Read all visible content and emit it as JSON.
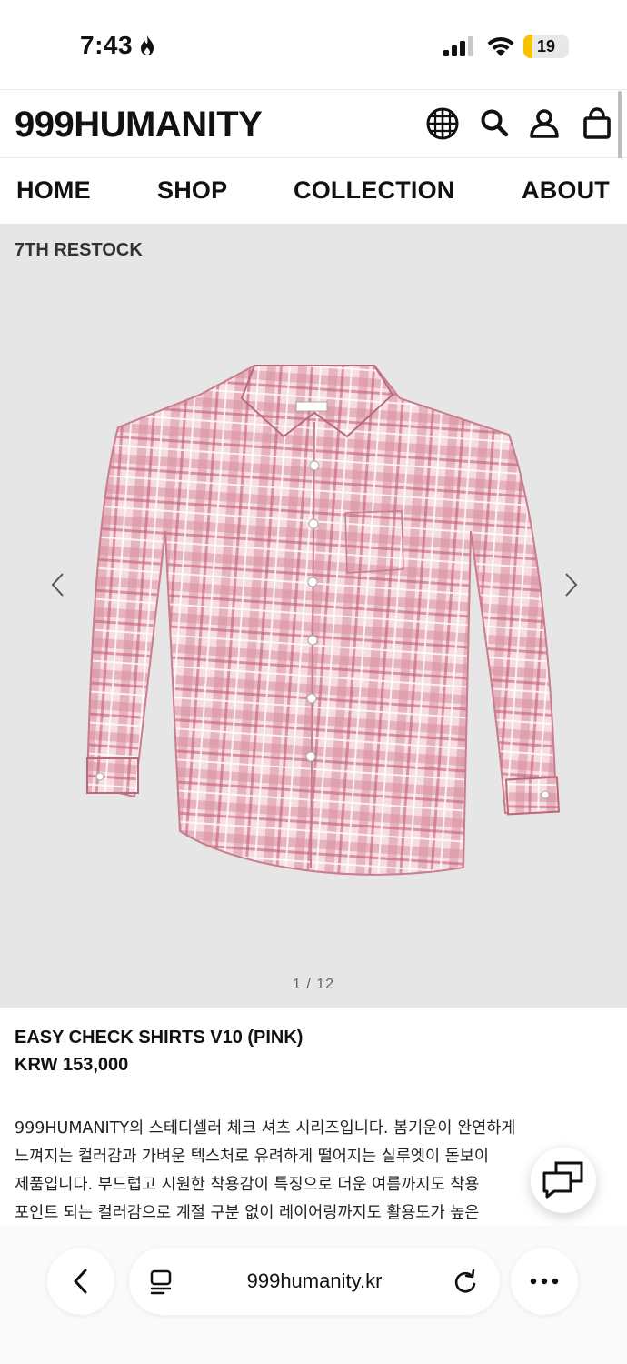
{
  "status": {
    "time": "7:43",
    "battery_percent": 19,
    "battery_text": "19"
  },
  "header": {
    "logo": "999HUMANITY",
    "icons": [
      "globe-icon",
      "search-icon",
      "account-icon",
      "bag-icon"
    ]
  },
  "nav": {
    "items": [
      {
        "label": "HOME"
      },
      {
        "label": "SHOP"
      },
      {
        "label": "COLLECTION"
      },
      {
        "label": "ABOUT"
      }
    ]
  },
  "gallery": {
    "badge": "7TH RESTOCK",
    "counter": "1 / 12",
    "current": 1,
    "total": 12
  },
  "product": {
    "title": "EASY CHECK SHIRTS V10 (PINK)",
    "price": "KRW 153,000",
    "description_lines": [
      "999HUMANITY의 스테디셀러 체크 셔츠 시리즈입니다. 봄기운이 완연하게",
      "느껴지는 컬러감과 가벼운 텍스처로 유려하게 떨어지는 실루엣이 돋보이",
      "제품입니다. 부드럽고 시원한 착용감이 특징으로 더운 여름까지도 착용",
      "포인트 되는 컬러감으로 계절 구분 없이 레이어링까지도 활용도가 높은"
    ]
  },
  "browser": {
    "url": "999humanity.kr"
  },
  "colors": {
    "gallery_bg": "#e6e6e6",
    "shirt_base": "#f2cfd6",
    "shirt_check": "#cf6f84",
    "battery": "#f5c400"
  }
}
